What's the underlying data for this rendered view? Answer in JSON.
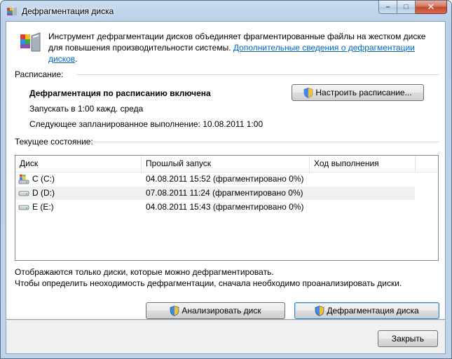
{
  "window": {
    "title": "Дефрагментация диска"
  },
  "intro": {
    "text": "Инструмент дефрагментации дисков объединяет фрагментированные файлы на жестком диске для повышения производительности системы. ",
    "link": "Дополнительные сведения о дефрагментации дисков",
    "after_link": "."
  },
  "schedule": {
    "label": "Расписание:",
    "status": "Дефрагментация по расписанию включена",
    "run": "Запускать в 1:00 кажд. среда",
    "next_run": "Следующее запланированное выполнение: 10.08.2011 1:00",
    "configure_button": "Настроить расписание..."
  },
  "current_state": {
    "label": "Текущее состояние:",
    "columns": [
      "Диск",
      "Прошлый запуск",
      "Ход выполнения"
    ],
    "rows": [
      {
        "disk": "C (C:)",
        "last_run": "04.08.2011 15:52 (фрагментировано 0%)",
        "progress": "",
        "icon": "system-drive-icon"
      },
      {
        "disk": "D (D:)",
        "last_run": "07.08.2011 11:24 (фрагментировано 0%)",
        "progress": "",
        "icon": "hard-drive-icon"
      },
      {
        "disk": "E (E:)",
        "last_run": "04.08.2011 15:43 (фрагментировано 0%)",
        "progress": "",
        "icon": "hard-drive-icon"
      }
    ]
  },
  "notes": {
    "line1": "Отображаются только диски, которые можно дефрагментировать.",
    "line2": "Чтобы определить неоходимость  дефрагментации, сначала необходимо проанализировать диски."
  },
  "actions": {
    "analyze": "Анализировать диск",
    "defrag": "Дефрагментация диска",
    "close": "Закрыть"
  },
  "icons": {
    "app": "defrag-app-icon",
    "shield": "uac-shield-icon"
  }
}
